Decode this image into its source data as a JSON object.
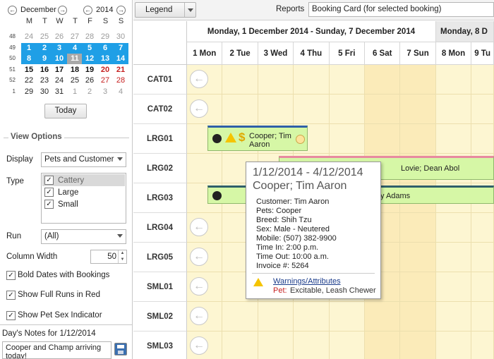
{
  "calendar": {
    "month": "December",
    "year": "2014",
    "dows": [
      "M",
      "T",
      "W",
      "T",
      "F",
      "S",
      "S"
    ],
    "weeks": [
      "48",
      "49",
      "50",
      "51",
      "52",
      "1"
    ],
    "rows": [
      [
        "24",
        "25",
        "26",
        "27",
        "28",
        "29",
        "30"
      ],
      [
        "1",
        "2",
        "3",
        "4",
        "5",
        "6",
        "7"
      ],
      [
        "8",
        "9",
        "10",
        "11",
        "12",
        "13",
        "14"
      ],
      [
        "15",
        "16",
        "17",
        "18",
        "19",
        "20",
        "21"
      ],
      [
        "22",
        "23",
        "24",
        "25",
        "26",
        "27",
        "28"
      ],
      [
        "29",
        "30",
        "31",
        "1",
        "2",
        "3",
        "4"
      ]
    ],
    "today_label": "Today"
  },
  "view_options": {
    "title": "View Options",
    "display_label": "Display",
    "display_value": "Pets and Customer",
    "type_label": "Type",
    "types": [
      "Cattery",
      "Large",
      "Small"
    ],
    "run_label": "Run",
    "run_value": "(All)",
    "col_width_label": "Column Width",
    "col_width_value": "50",
    "bold_dates": "Bold Dates with Bookings",
    "full_runs": "Show Full Runs in Red",
    "sex_indicator": "Show Pet Sex Indicator"
  },
  "notes": {
    "label": "Day's Notes for 1/12/2014",
    "text": "Cooper and Champ arriving today!"
  },
  "toolbar": {
    "legend": "Legend",
    "reports_label": "Reports",
    "reports_value": "Booking Card (for selected booking)"
  },
  "grid": {
    "week1": "Monday, 1 December 2014 - Sunday, 7 December 2014",
    "week2": "Monday, 8 D",
    "days": [
      "1 Mon",
      "2 Tue",
      "3 Wed",
      "4 Thu",
      "5 Fri",
      "6 Sat",
      "7 Sun",
      "8 Mon",
      "9 Tu"
    ],
    "runs": [
      "CAT01",
      "CAT02",
      "LRG01",
      "LRG02",
      "LRG03",
      "LRG04",
      "LRG05",
      "SML01",
      "SML02",
      "SML03"
    ]
  },
  "bookings": {
    "b1": "Cooper; Tim Aaron",
    "b2": "Lovie; Dean Abol",
    "b3": "y Adams"
  },
  "tooltip": {
    "dates": "1/12/2014 - 4/12/2014",
    "name": "Cooper; Tim Aaron",
    "customer": "Customer: Tim Aaron",
    "pets": "Pets: Cooper",
    "breed": "Breed: Shih Tzu",
    "sex": "Sex: Male - Neutered",
    "mobile": "Mobile: (507) 382-9900",
    "time_in": "Time In: 2:00 p.m.",
    "time_out": "Time Out: 10:00 a.m.",
    "invoice": "Invoice #: 5264",
    "warn_title": "Warnings/Attributes",
    "warn_pet_label": "Pet:",
    "warn_pet_value": "Excitable, Leash Chewer"
  }
}
